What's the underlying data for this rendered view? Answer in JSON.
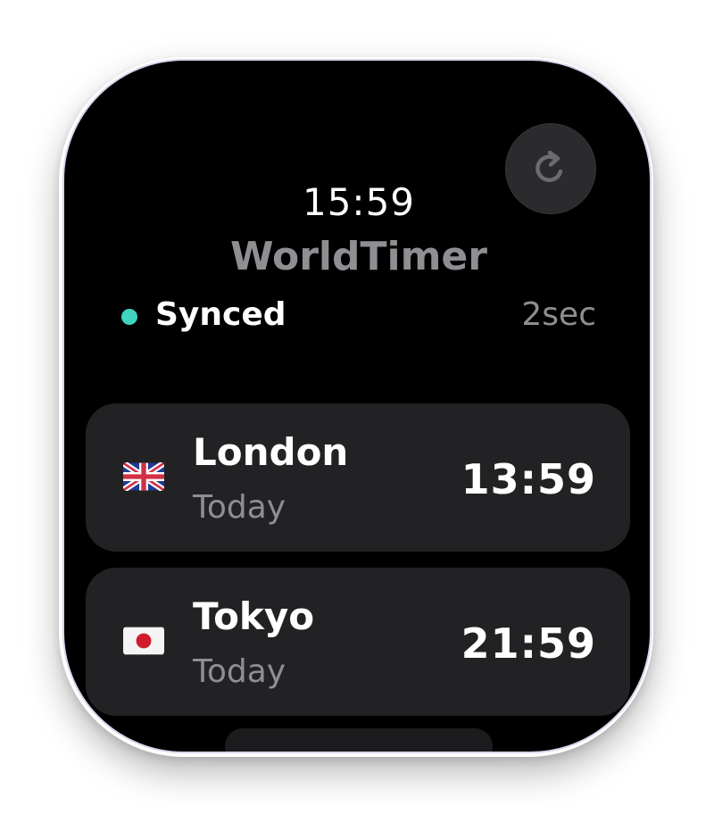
{
  "header": {
    "time": "15:59",
    "app_title": "WorldTimer",
    "refresh_icon": "refresh-icon"
  },
  "status": {
    "label": "Synced",
    "age": "2sec",
    "dot_color": "#3fd3c0"
  },
  "cities": [
    {
      "flag_icon": "uk-flag-icon",
      "name": "London",
      "day": "Today",
      "time": "13:59"
    },
    {
      "flag_icon": "japan-flag-icon",
      "name": "Tokyo",
      "day": "Today",
      "time": "21:59"
    }
  ],
  "colors": {
    "background": "#000000",
    "card": "#222224",
    "secondary_text": "#8e8e93",
    "accent": "#3fd3c0"
  }
}
